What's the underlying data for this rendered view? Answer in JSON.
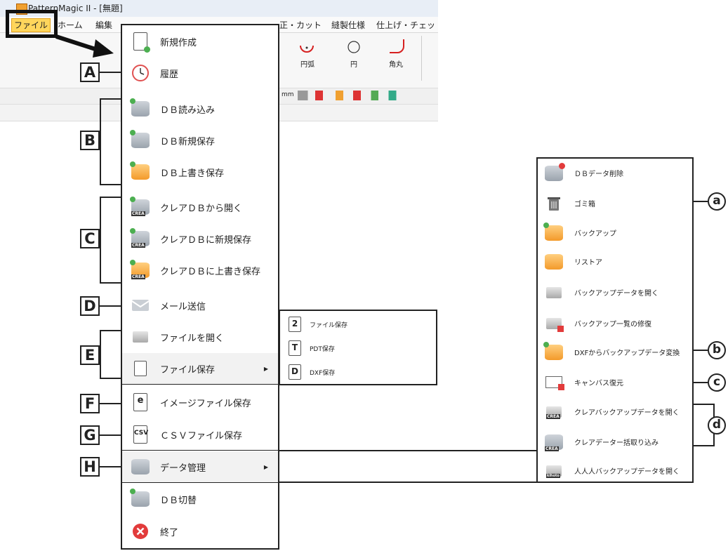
{
  "app": {
    "title": "PatternMagic II - [無題]",
    "menubar": [
      "ファイル",
      "ホーム",
      "編集",
      "正・カット",
      "縫製仕様",
      "仕上げ・チェック"
    ],
    "ribbon_tools": [
      "円弧",
      "円",
      "角丸"
    ],
    "unit": "mm"
  },
  "main_menu": {
    "items": [
      {
        "label": "新規作成",
        "icon": "new-document-icon"
      },
      {
        "label": "履歴",
        "icon": "clock-icon"
      },
      {
        "label": "ＤＢ読み込み",
        "icon": "db-load-icon"
      },
      {
        "label": "ＤＢ新規保存",
        "icon": "db-new-save-icon"
      },
      {
        "label": "ＤＢ上書き保存",
        "icon": "db-overwrite-icon"
      },
      {
        "label": "クレアＤＢから開く",
        "icon": "crea-db-open-icon"
      },
      {
        "label": "クレアＤＢに新規保存",
        "icon": "crea-db-new-save-icon"
      },
      {
        "label": "クレアＤＢに上書き保存",
        "icon": "crea-db-overwrite-icon"
      },
      {
        "label": "メール送信",
        "icon": "mail-icon"
      },
      {
        "label": "ファイルを開く",
        "icon": "folder-icon"
      },
      {
        "label": "ファイル保存",
        "icon": "file-save-icon"
      },
      {
        "label": "イメージファイル保存",
        "icon": "image-file-icon"
      },
      {
        "label": "ＣＳＶファイル保存",
        "icon": "csv-file-icon"
      },
      {
        "label": "データ管理",
        "icon": "data-manage-icon"
      },
      {
        "label": "ＤＢ切替",
        "icon": "db-switch-icon"
      },
      {
        "label": "終了",
        "icon": "exit-icon"
      }
    ]
  },
  "file_save_submenu": [
    {
      "label": "ファイル保存",
      "icon_text": "2"
    },
    {
      "label": "PDT保存",
      "icon_text": "T"
    },
    {
      "label": "DXF保存",
      "icon_text": "D"
    }
  ],
  "data_submenu": [
    {
      "label": "ＤＢデータ削除"
    },
    {
      "label": "ゴミ箱"
    },
    {
      "label": "バックアップ"
    },
    {
      "label": "リストア"
    },
    {
      "label": "バックアップデータを開く"
    },
    {
      "label": "バックアップ一覧の修復"
    },
    {
      "label": "DXFからバックアップデータ変換"
    },
    {
      "label": "キャンバス復元"
    },
    {
      "label": "クレアバックアップデータを開く"
    },
    {
      "label": "クレアデーター括取り込み"
    },
    {
      "label": "人人人バックアップデータを開く"
    }
  ],
  "letter_labels": [
    "A",
    "B",
    "C",
    "D",
    "E",
    "F",
    "G",
    "H"
  ],
  "circle_labels": [
    "a",
    "b",
    "c",
    "d"
  ],
  "icon_badge_texts": {
    "crea": "CREA",
    "kihoto": "kihoto",
    "csv": "CSV",
    "e": "e"
  },
  "colors": {
    "accent": "#ffd65c",
    "border": "#222222"
  }
}
